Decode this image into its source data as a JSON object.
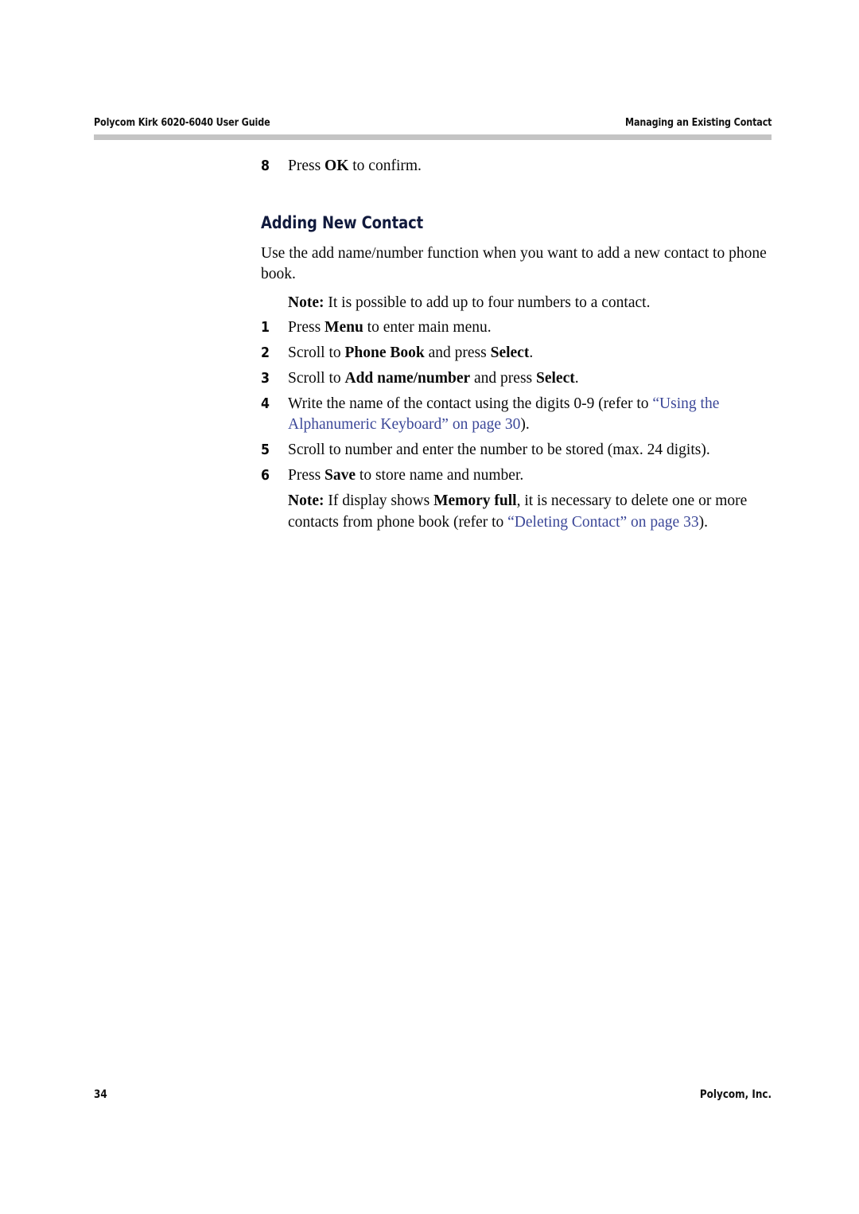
{
  "document": {
    "header": {
      "left": "Polycom Kirk 6020-6040 User Guide",
      "right": "Managing an Existing Contact"
    },
    "footer": {
      "page_number": "34",
      "publisher": "Polycom, Inc."
    },
    "colors": {
      "text": "#0a0a0a",
      "heading": "#111a3d",
      "cross_reference_link": "#3b4798",
      "rule": "#c4c4c4",
      "background": "#ffffff"
    },
    "continued_step": {
      "number": "8",
      "text_before_bold": "Press ",
      "bold": "OK",
      "text_after_bold": " to confirm."
    },
    "section": {
      "heading": "Adding New Contact",
      "intro": "Use the add name/number function when you want to add a new contact to phone book.",
      "note_top": {
        "label": "Note:",
        "text": " It is possible to add up to four numbers to a contact."
      },
      "steps": [
        {
          "number": "1",
          "parts": [
            {
              "text": "Press ",
              "style": "normal"
            },
            {
              "text": "Menu",
              "style": "bold"
            },
            {
              "text": " to enter main menu.",
              "style": "normal"
            }
          ]
        },
        {
          "number": "2",
          "parts": [
            {
              "text": "Scroll to ",
              "style": "normal"
            },
            {
              "text": "Phone Book",
              "style": "bold"
            },
            {
              "text": " and press ",
              "style": "normal"
            },
            {
              "text": "Select",
              "style": "bold"
            },
            {
              "text": ".",
              "style": "normal"
            }
          ]
        },
        {
          "number": "3",
          "parts": [
            {
              "text": "Scroll to ",
              "style": "normal"
            },
            {
              "text": "Add name/number",
              "style": "bold"
            },
            {
              "text": " and press ",
              "style": "normal"
            },
            {
              "text": "Select",
              "style": "bold"
            },
            {
              "text": ".",
              "style": "normal"
            }
          ]
        },
        {
          "number": "4",
          "parts": [
            {
              "text": "Write the name of the contact using the digits 0-9 (refer to ",
              "style": "normal"
            },
            {
              "text": "“Using the Alphanumeric Keyboard” on page 30",
              "style": "link"
            },
            {
              "text": ").",
              "style": "normal"
            }
          ]
        },
        {
          "number": "5",
          "parts": [
            {
              "text": "Scroll to number and enter the number to be stored (max. 24 digits).",
              "style": "normal"
            }
          ]
        },
        {
          "number": "6",
          "parts": [
            {
              "text": "Press ",
              "style": "normal"
            },
            {
              "text": "Save",
              "style": "bold"
            },
            {
              "text": " to store name and number.",
              "style": "normal"
            }
          ]
        }
      ],
      "note_bottom": {
        "parts": [
          {
            "text": "Note:",
            "style": "bold"
          },
          {
            "text": " If display shows ",
            "style": "normal"
          },
          {
            "text": "Memory full",
            "style": "bold"
          },
          {
            "text": ", it is necessary to delete one or more contacts from phone book (refer to ",
            "style": "normal"
          },
          {
            "text": "“Deleting Contact” on page 33",
            "style": "link"
          },
          {
            "text": ").",
            "style": "normal"
          }
        ]
      }
    }
  }
}
